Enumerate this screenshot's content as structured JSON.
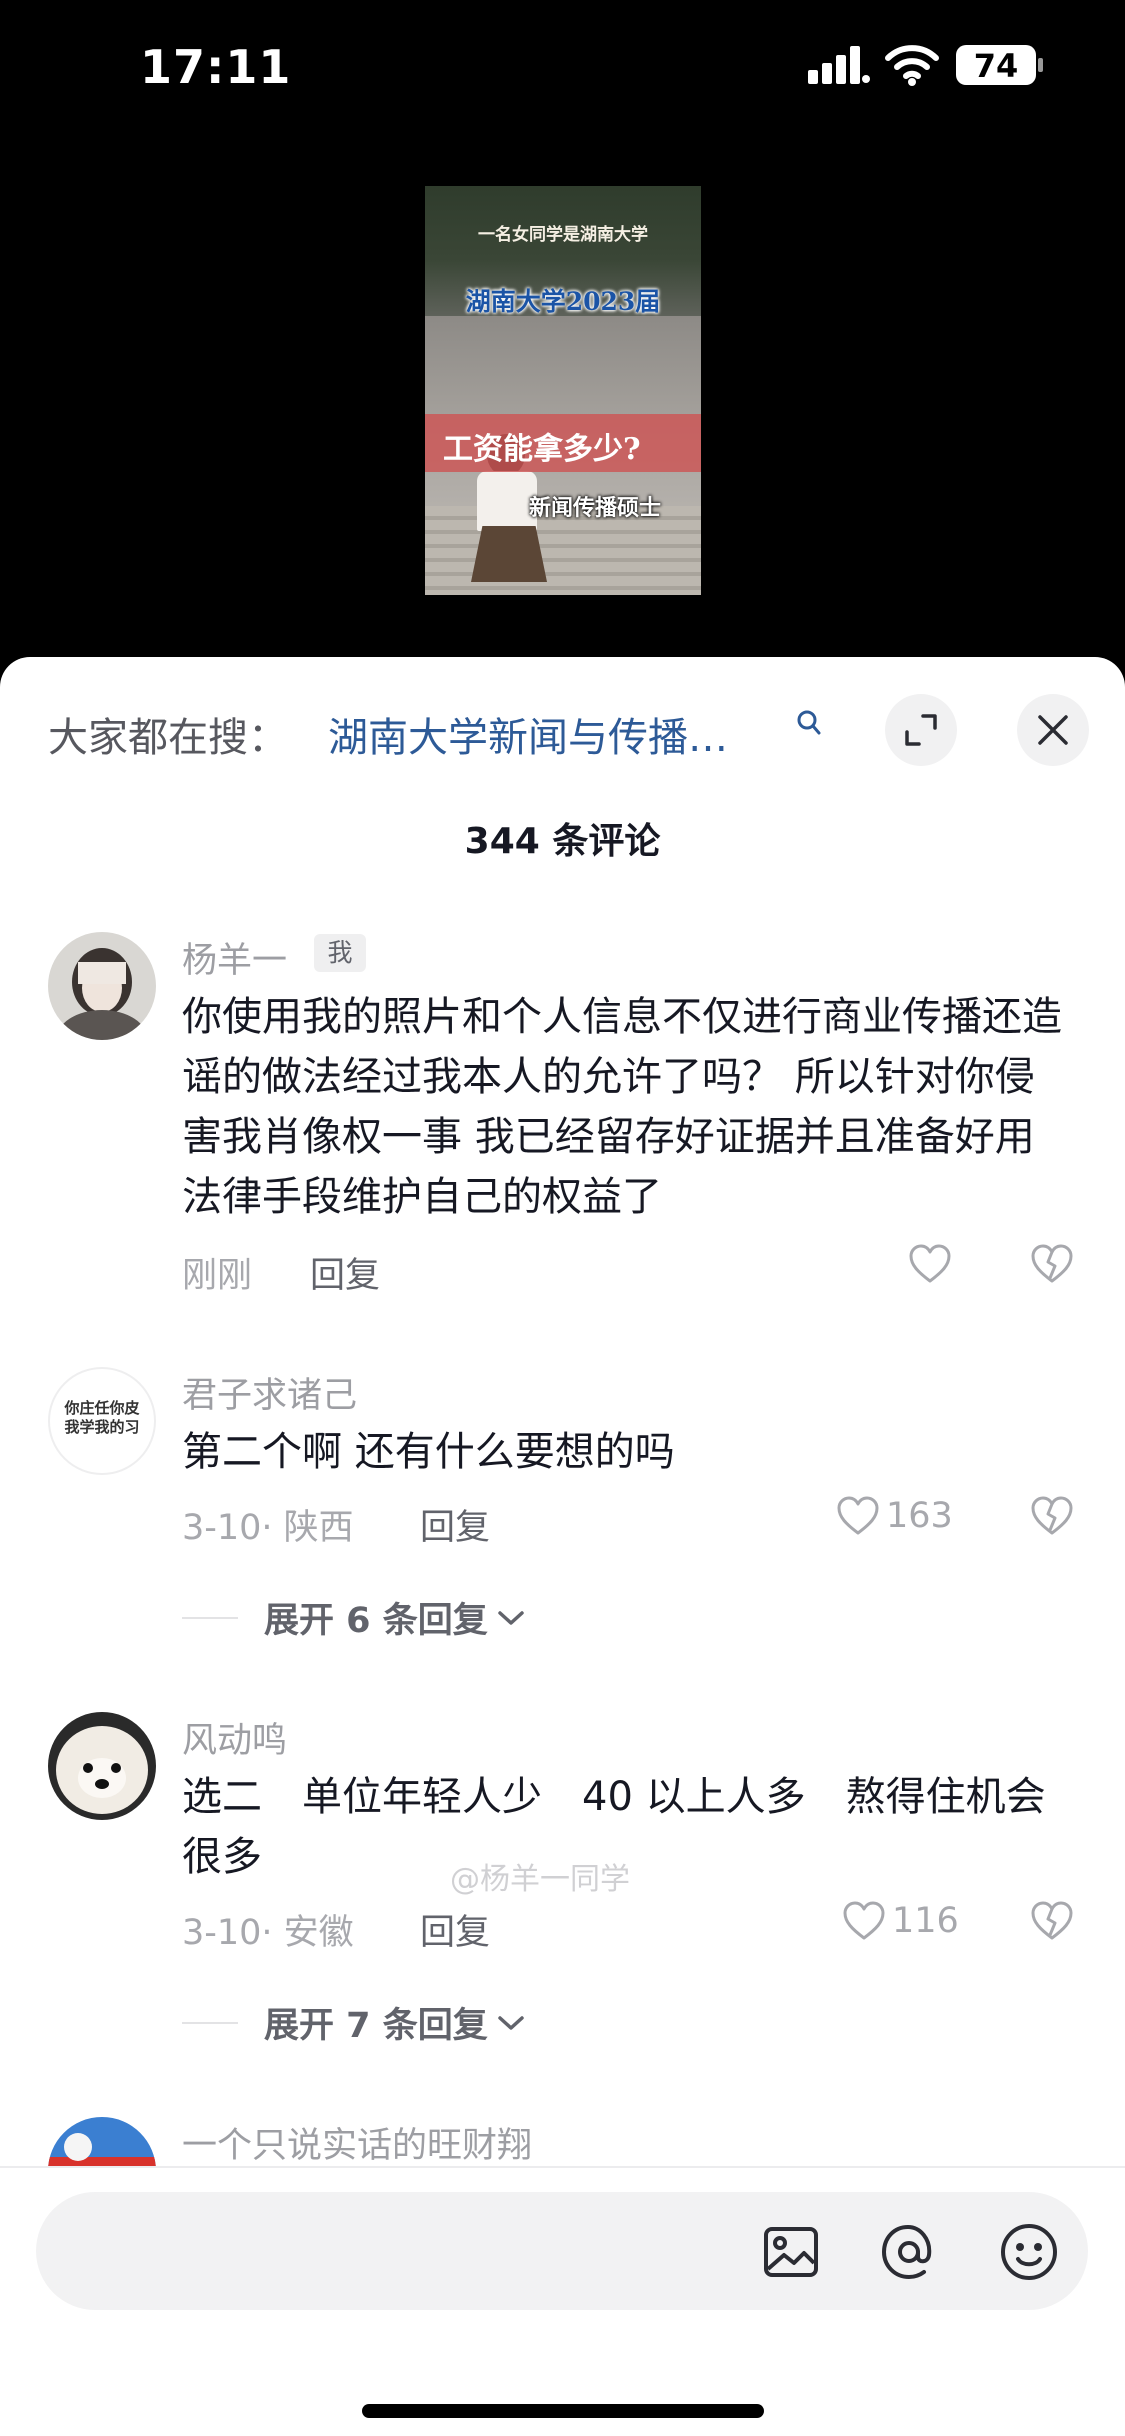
{
  "status_bar": {
    "time": "17:11",
    "battery": "74"
  },
  "video": {
    "caption_top": "一名女同学是湖南大学",
    "caption_mid": "湖南大学2023届",
    "caption_band": "工资能拿多少?",
    "caption_bottom": "新闻传播硕士"
  },
  "search": {
    "prefix": "大家都在搜：",
    "query": "湖南大学新闻与传播…"
  },
  "comments_count": "344 条评论",
  "comments": [
    {
      "username": "杨羊一",
      "tag": "我",
      "content": "你使用我的照片和个人信息不仅进行商业传播还造谣的做法经过我本人的允许了吗？ 所以针对你侵害我肖像权一事 我已经留存好证据并且准备好用法律手段维护自己的权益了",
      "time": "刚刚",
      "reply_label": "回复",
      "likes": ""
    },
    {
      "username": "君子求诸己",
      "avatar_text": "你庄任你皮 我学我的习",
      "content": "第二个啊 还有什么要想的吗",
      "time": "3-10· 陕西",
      "reply_label": "回复",
      "likes": "163",
      "expand_label": "展开 6 条回复"
    },
    {
      "username": "风动鸣",
      "content": "选二　单位年轻人少　40 以上人多　熬得住机会很多",
      "time": "3-10· 安徽",
      "reply_label": "回复",
      "likes": "116",
      "expand_label": "展开 7 条回复"
    },
    {
      "username": "一个只说实话的旺财翔"
    }
  ],
  "watermark": "@杨羊一同学"
}
